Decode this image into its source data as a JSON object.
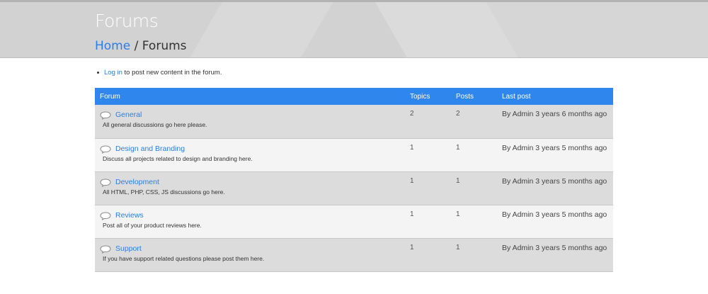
{
  "header": {
    "title": "Forums"
  },
  "breadcrumb": {
    "home": "Home",
    "separator": " / ",
    "current": "Forums"
  },
  "login_note": {
    "link": "Log in",
    "text": " to post new content in the forum."
  },
  "table": {
    "headers": {
      "forum": "Forum",
      "topics": "Topics",
      "posts": "Posts",
      "last_post": "Last post"
    },
    "rows": [
      {
        "name": "General",
        "description": "All general discussions go here please.",
        "topics": "2",
        "posts": "2",
        "last_post": "By Admin 3 years 6 months ago"
      },
      {
        "name": "Design and Branding",
        "description": "Discuss all projects related to design and branding here.",
        "topics": "1",
        "posts": "1",
        "last_post": "By Admin 3 years 5 months ago"
      },
      {
        "name": "Development",
        "description": "All HTML, PHP, CSS, JS discussions go here.",
        "topics": "1",
        "posts": "1",
        "last_post": "By Admin 3 years 5 months ago"
      },
      {
        "name": "Reviews",
        "description": "Post all of your product reviews here.",
        "topics": "1",
        "posts": "1",
        "last_post": "By Admin 3 years 5 months ago"
      },
      {
        "name": "Support",
        "description": "If you have support related questions please post them here.",
        "topics": "1",
        "posts": "1",
        "last_post": "By Admin 3 years 5 months ago"
      }
    ]
  },
  "colors": {
    "accent": "#2f86ec",
    "link": "#2a7ee6",
    "row_odd": "#dcdcdc",
    "row_even": "#f4f4f4",
    "header_bg": "#d6d6d6"
  },
  "icons": {
    "forum_icon": "speech-bubble-icon"
  }
}
